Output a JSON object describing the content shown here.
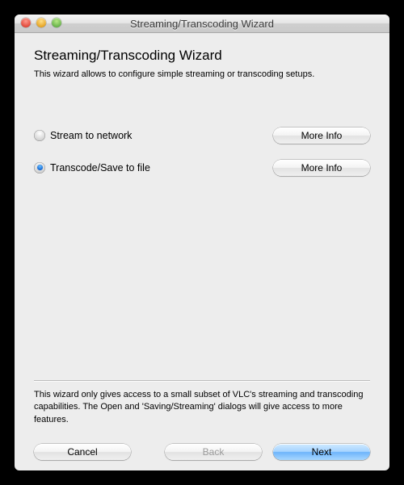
{
  "window": {
    "title": "Streaming/Transcoding Wizard"
  },
  "page": {
    "heading": "Streaming/Transcoding Wizard",
    "description": "This wizard allows to configure simple streaming or transcoding setups."
  },
  "options": [
    {
      "label": "Stream to network",
      "selected": false,
      "more_label": "More Info"
    },
    {
      "label": "Transcode/Save to file",
      "selected": true,
      "more_label": "More Info"
    }
  ],
  "footnote": "This wizard only gives access to a small subset of VLC's streaming and transcoding capabilities. The Open and 'Saving/Streaming' dialogs will give access to more features.",
  "buttons": {
    "cancel": "Cancel",
    "back": "Back",
    "next": "Next",
    "back_enabled": false
  }
}
